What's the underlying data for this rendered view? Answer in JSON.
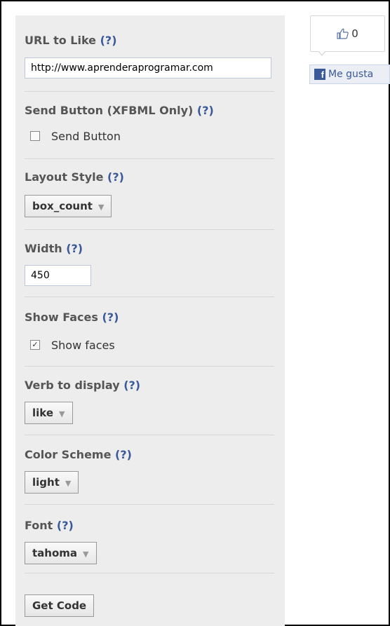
{
  "help_marker": "(?)",
  "url": {
    "label": "URL to Like",
    "value": "http://www.aprenderaprogramar.com"
  },
  "send": {
    "label": "Send Button (XFBML Only)",
    "checkbox_label": "Send Button",
    "checked": false
  },
  "layout": {
    "label": "Layout Style",
    "selected": "box_count"
  },
  "width": {
    "label": "Width",
    "value": "450"
  },
  "faces": {
    "label": "Show Faces",
    "checkbox_label": "Show faces",
    "checked": true
  },
  "verb": {
    "label": "Verb to display",
    "selected": "like"
  },
  "color": {
    "label": "Color Scheme",
    "selected": "light"
  },
  "font": {
    "label": "Font",
    "selected": "tahoma"
  },
  "get_code_label": "Get Code",
  "preview": {
    "like_count": "0",
    "button_label": "Me gusta",
    "brand_color": "#3b5998",
    "icons": [
      "thumbs-up-icon",
      "facebook-icon"
    ]
  }
}
